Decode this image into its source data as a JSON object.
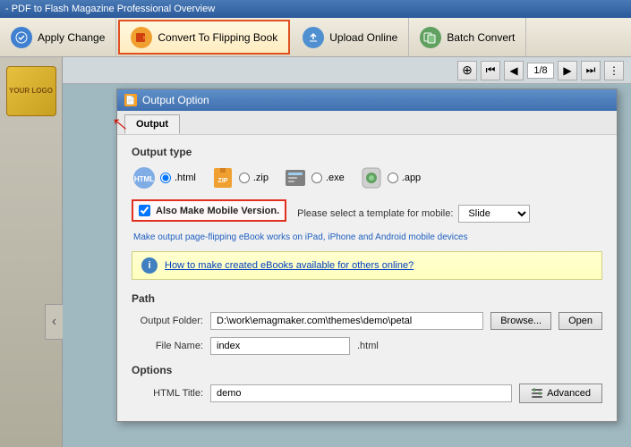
{
  "titleBar": {
    "text": "- PDF to Flash Magazine Professional Overview"
  },
  "toolbar": {
    "applyChange": "Apply Change",
    "convertToFlippingBook": "Convert To Flipping Book",
    "uploadOnline": "Upload Online",
    "batchConvert": "Batch Convert"
  },
  "viewControls": {
    "pageDisplay": "1/8"
  },
  "logo": {
    "text": "YOUR LOGO"
  },
  "dialog": {
    "title": "Output Option",
    "tab": "Output",
    "sectionLabel": "Output type",
    "outputTypes": [
      {
        "icon": "🌐",
        "radio": ".html",
        "selected": true
      },
      {
        "icon": "📦",
        "radio": ".zip",
        "selected": false
      },
      {
        "icon": "⚙️",
        "radio": ".exe",
        "selected": false
      },
      {
        "icon": "🍎",
        "radio": ".app",
        "selected": false
      }
    ],
    "mobileCheckboxLabel": "Also Make Mobile Version.",
    "mobileTemplateLabel": "Please select a template for mobile:",
    "mobileTemplateValue": "Slide",
    "mobileNote": "Make output page-flipping eBook works on iPad, iPhone and Android mobile devices",
    "infoLink": "How to make created eBooks available for others online?",
    "pathSection": {
      "label": "Path",
      "outputFolderLabel": "Output Folder:",
      "outputFolderValue": "D:\\work\\emagmaker.com\\themes\\demo\\petal",
      "browseBtn": "Browse...",
      "openBtn": "Open",
      "fileNameLabel": "File Name:",
      "fileNameValue": "index",
      "fileSuffix": ".html"
    },
    "optionsSection": {
      "label": "Options",
      "htmlTitleLabel": "HTML Title:",
      "htmlTitleValue": "demo",
      "advancedBtn": "Advanced"
    }
  }
}
